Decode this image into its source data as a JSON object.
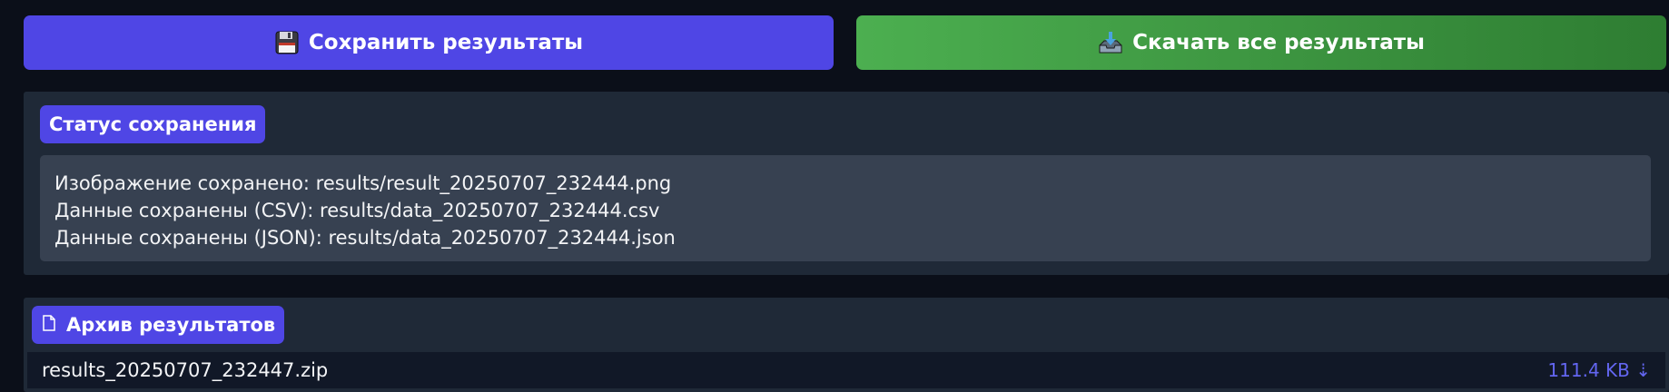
{
  "actions": {
    "save_label": "Сохранить результаты",
    "save_icon": "floppy-disk-icon",
    "download_label": "Скачать все результаты",
    "download_icon": "inbox-tray-icon"
  },
  "status_panel": {
    "title": "Статус сохранения",
    "lines": [
      "Изображение сохранено: results/result_20250707_232444.png",
      "Данные сохранены (CSV): results/data_20250707_232444.csv",
      "Данные сохранены (JSON): results/data_20250707_232444.json"
    ]
  },
  "archive_panel": {
    "title": "Архив результатов",
    "title_icon": "file-icon",
    "file": {
      "name": "results_20250707_232447.zip",
      "size": "111.4 KB ⇣"
    }
  },
  "colors": {
    "background": "#0b0f19",
    "accent": "#4f46e5",
    "download_green": "#4caf50",
    "panel": "#1f2937",
    "status_box": "#374151",
    "file_row": "#111827",
    "link": "#6366f1"
  }
}
